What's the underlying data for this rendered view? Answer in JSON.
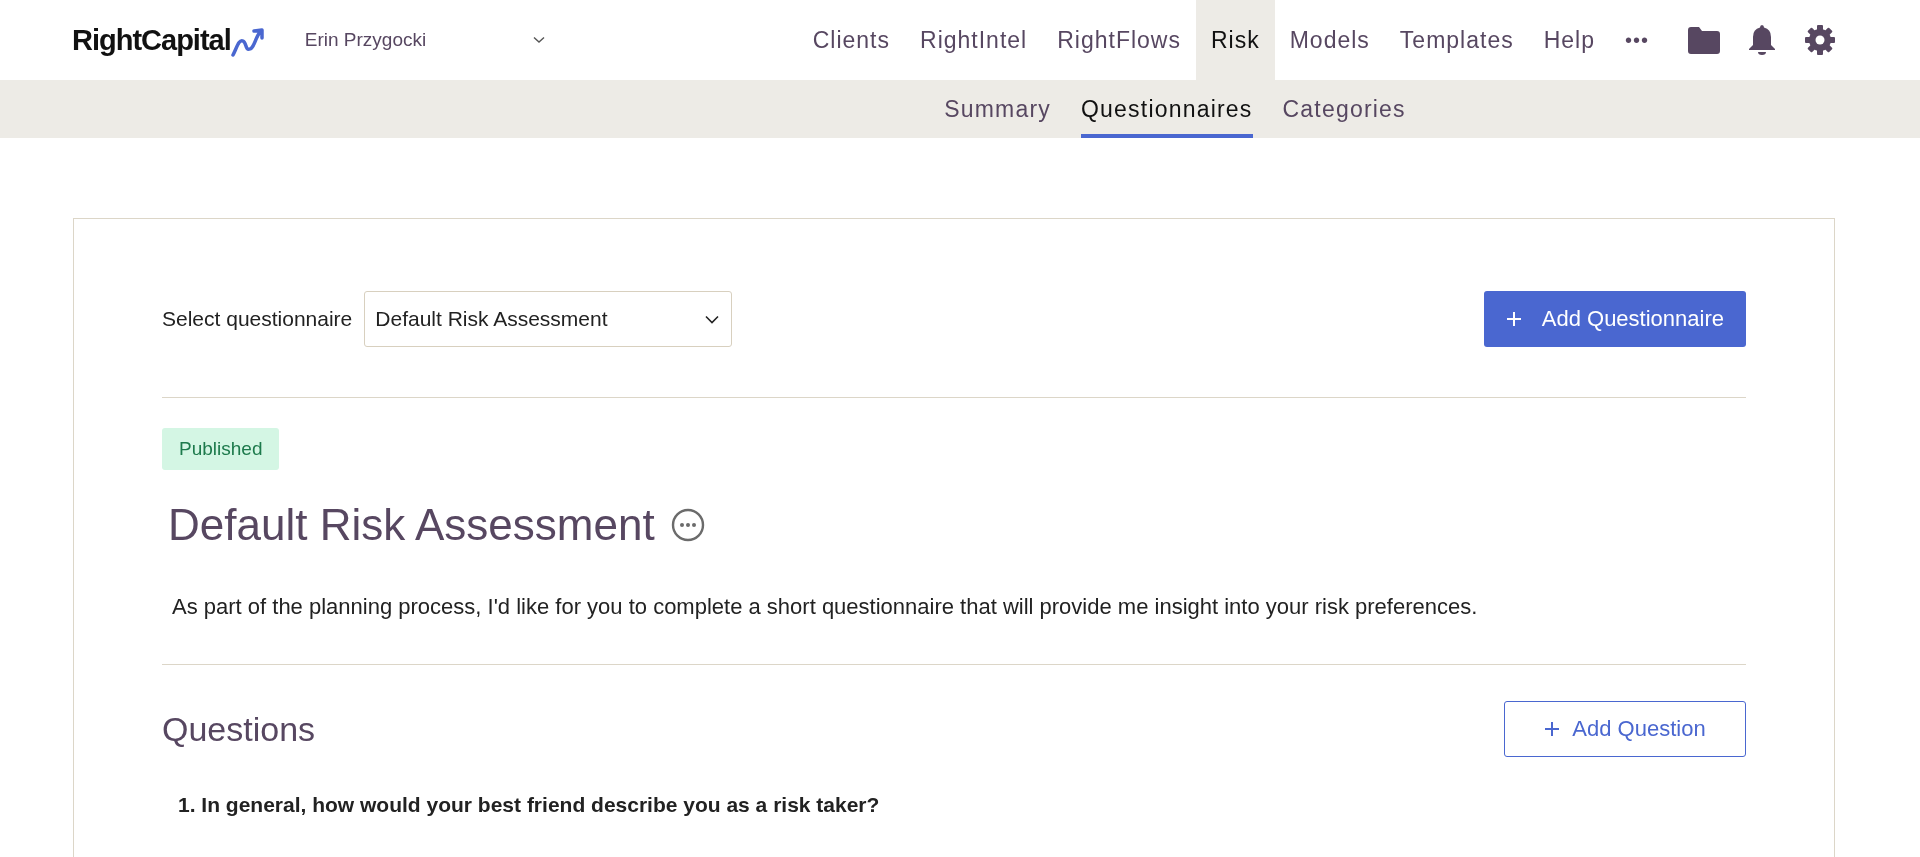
{
  "header": {
    "logo": "RightCapital",
    "client": "Erin Przygocki",
    "nav": [
      {
        "label": "Clients",
        "selected": false
      },
      {
        "label": "RightIntel",
        "selected": false
      },
      {
        "label": "RightFlows",
        "selected": false
      },
      {
        "label": "Risk",
        "selected": true
      },
      {
        "label": "Models",
        "selected": false
      },
      {
        "label": "Templates",
        "selected": false
      },
      {
        "label": "Help",
        "selected": false
      }
    ],
    "more": "•••"
  },
  "subnav": [
    {
      "label": "Summary",
      "selected": false
    },
    {
      "label": "Questionnaires",
      "selected": true
    },
    {
      "label": "Categories",
      "selected": false
    }
  ],
  "questionnaire": {
    "select_label": "Select questionnaire",
    "select_value": "Default Risk Assessment",
    "add_button": "Add Questionnaire",
    "status": "Published",
    "title": "Default Risk Assessment",
    "description": "As part of the planning process, I'd like for you to complete a short questionnaire that will provide me insight into your risk preferences."
  },
  "questions": {
    "heading": "Questions",
    "add_button": "Add Question",
    "items": [
      "1. In general, how would your best friend describe you as a risk taker?"
    ]
  }
}
